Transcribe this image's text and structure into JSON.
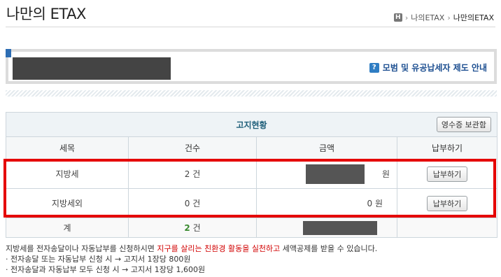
{
  "header": {
    "title": "나만의 ETAX",
    "breadcrumb": {
      "home_glyph": "H",
      "parent": "나의ETAX",
      "current": "나만의ETAX"
    }
  },
  "user_panel": {
    "guide_link": "모범 및 유공납세자 제도 안내",
    "guide_icon": "question-icon"
  },
  "table": {
    "caption": "고지현황",
    "receipt_button": "영수증 보관함",
    "columns": [
      "세목",
      "건수",
      "금액",
      "납부하기"
    ],
    "rows": [
      {
        "tax": "지방세",
        "count": "2 건",
        "amount_unit": "원",
        "pay_label": "납부하기"
      },
      {
        "tax": "지방세외",
        "count": "0 건",
        "amount": "0 원",
        "pay_label": "납부하기"
      }
    ],
    "total": {
      "label": "계",
      "count_num": "2",
      "count_unit": "건"
    }
  },
  "notice": {
    "line1_a": "지방세를 전자송달이나 자동납부를 신청하시면 ",
    "line1_red": "지구를 살리는 친환경 활동을 실천하고",
    "line1_b": " 세액공제를 받을 수 있습니다.",
    "line2": "· 전자송달 또는 자동납부 신청 시 → 고지서 1장당 800원",
    "line3": "· 전자송달과 자동납부 모두 신청 시 → 고지서 1장당 1,600원"
  },
  "colors": {
    "highlight": "#e50000",
    "link": "#1d4f91",
    "accent": "#2d6db3",
    "total_count": "#3a8a2f"
  }
}
